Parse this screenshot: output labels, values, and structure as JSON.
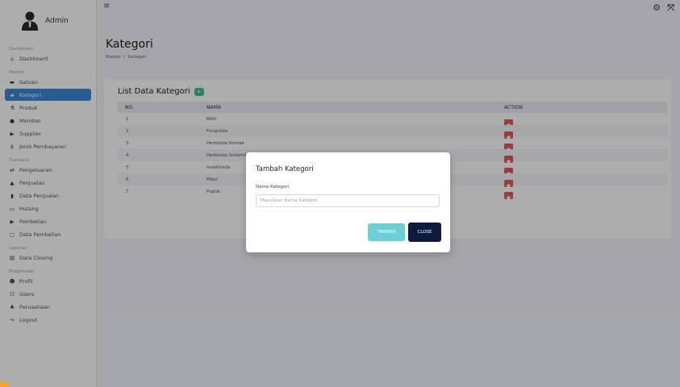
{
  "brand": {
    "name": "Admin"
  },
  "sidebar": {
    "sections": [
      {
        "label": "Dashboard",
        "items": [
          {
            "label": "Dashboard",
            "icon": "home-icon",
            "active": false
          }
        ]
      },
      {
        "label": "Master",
        "items": [
          {
            "label": "Satuan",
            "icon": "folder-icon",
            "active": false
          },
          {
            "label": "Kategori",
            "icon": "folder-open-icon",
            "active": true
          },
          {
            "label": "Produk",
            "icon": "flask-icon",
            "active": false
          },
          {
            "label": "Member",
            "icon": "user-icon",
            "active": false
          },
          {
            "label": "Supplier",
            "icon": "truck-icon",
            "active": false
          },
          {
            "label": "Jenis Pembayaran",
            "icon": "dollar-icon",
            "active": false
          }
        ]
      },
      {
        "label": "Transaksi",
        "items": [
          {
            "label": "Pengeluaran",
            "icon": "exchange-icon",
            "active": false
          },
          {
            "label": "Penjualan",
            "icon": "bag-icon",
            "active": false
          },
          {
            "label": "Data Penjualan",
            "icon": "chart-icon",
            "active": false
          },
          {
            "label": "Hutang",
            "icon": "card-icon",
            "active": false
          },
          {
            "label": "Pembelian",
            "icon": "truck-icon",
            "active": false
          },
          {
            "label": "Data Pembelian",
            "icon": "clipboard-icon",
            "active": false
          }
        ]
      },
      {
        "label": "Laporan",
        "items": [
          {
            "label": "Data Closing",
            "icon": "file-icon",
            "active": false
          }
        ]
      },
      {
        "label": "Pengaturan",
        "items": [
          {
            "label": "Profil",
            "icon": "users-icon",
            "active": false
          },
          {
            "label": "Users",
            "icon": "users-cog-icon",
            "active": false
          },
          {
            "label": "Perusahaan",
            "icon": "people-icon",
            "active": false
          },
          {
            "label": "Logout",
            "icon": "logout-icon",
            "active": false
          }
        ]
      }
    ]
  },
  "header": {
    "title": "Kategori",
    "breadcrumb": [
      "Master",
      "Kategori"
    ]
  },
  "list": {
    "title": "List Data Kategori",
    "add_label": "+",
    "columns": [
      "NO.",
      "NAMA",
      "ACTION"
    ],
    "rows": [
      {
        "no": "1",
        "nama": "Bibit"
      },
      {
        "no": "2",
        "nama": "Fungisida"
      },
      {
        "no": "3",
        "nama": "Herbisida Kontak"
      },
      {
        "no": "4",
        "nama": "Herbisida Sistemik"
      },
      {
        "no": "5",
        "nama": "Insektisida"
      },
      {
        "no": "6",
        "nama": "Piber"
      },
      {
        "no": "7",
        "nama": "Pupuk"
      }
    ]
  },
  "modal": {
    "title": "Tambah Kategori",
    "field_label": "Nama Kategori",
    "field_placeholder": "Masukkan Nama Kategori",
    "field_value": "",
    "submit_label": "TAMBAH",
    "close_label": "CLOSE"
  },
  "colors": {
    "primary": "#3b8ad9",
    "success": "#3dbf8a",
    "danger": "#e05b5b",
    "dark": "#0d1b3e",
    "teal": "#6ccfd6"
  }
}
